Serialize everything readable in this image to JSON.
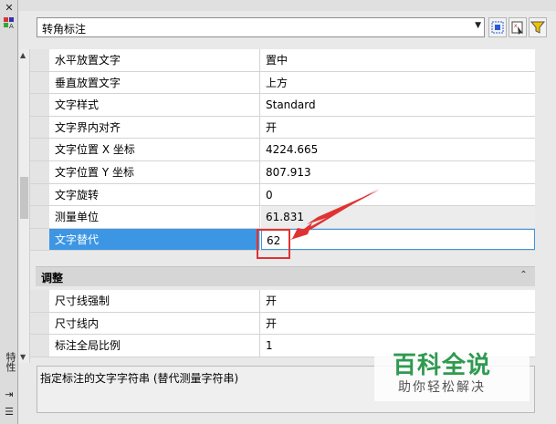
{
  "left_strip": {
    "top_icons": [
      "close-icon",
      "properties-icon"
    ],
    "vertical_title": "特性",
    "bottom_icons": [
      "autohide-icon",
      "menu-icon"
    ]
  },
  "combo": {
    "value": "转角标注",
    "arrow": "▼"
  },
  "toolbar": {
    "buttons": [
      "quick-select-icon",
      "select-objects-icon",
      "toggle-pickadd-icon"
    ]
  },
  "properties": [
    {
      "name": "水平放置文字",
      "value": "置中",
      "readonly": false,
      "selected": false
    },
    {
      "name": "垂直放置文字",
      "value": "上方",
      "readonly": false,
      "selected": false
    },
    {
      "name": "文字样式",
      "value": "Standard",
      "readonly": false,
      "selected": false
    },
    {
      "name": "文字界内对齐",
      "value": "开",
      "readonly": false,
      "selected": false
    },
    {
      "name": "文字位置 X 坐标",
      "value": "4224.665",
      "readonly": false,
      "selected": false
    },
    {
      "name": "文字位置 Y 坐标",
      "value": "807.913",
      "readonly": false,
      "selected": false
    },
    {
      "name": "文字旋转",
      "value": "0",
      "readonly": false,
      "selected": false
    },
    {
      "name": "测量单位",
      "value": "61.831",
      "readonly": true,
      "selected": false
    },
    {
      "name": "文字替代",
      "value": "62",
      "readonly": false,
      "selected": true
    }
  ],
  "section": {
    "title": "调整",
    "collapse_glyph": "⌃"
  },
  "properties2": [
    {
      "name": "尺寸线强制",
      "value": "开"
    },
    {
      "name": "尺寸线内",
      "value": "开"
    },
    {
      "name": "标注全局比例",
      "value": "1"
    }
  ],
  "description": "指定标注的文字字符串 (替代测量字符串)",
  "watermark": {
    "title": "百科全说",
    "subtitle": "助你轻松解决"
  },
  "colors": {
    "selection": "#3c96e4",
    "annotation": "#e03232",
    "watermark": "#2f9a50"
  }
}
